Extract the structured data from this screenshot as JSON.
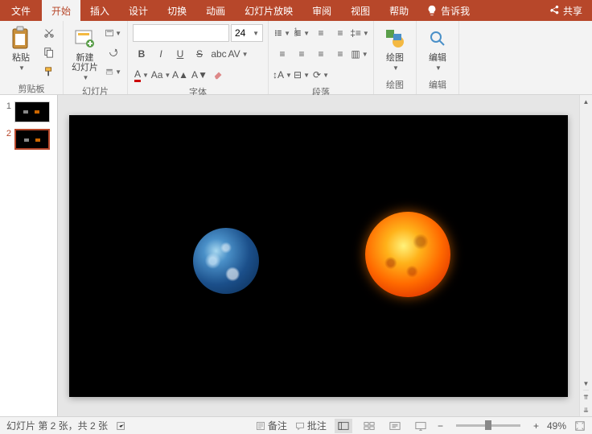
{
  "tabs": {
    "file": "文件",
    "home": "开始",
    "insert": "插入",
    "design": "设计",
    "transitions": "切换",
    "animations": "动画",
    "slideshow": "幻灯片放映",
    "review": "审阅",
    "view": "视图",
    "help": "帮助",
    "tellme": "告诉我",
    "share": "共享"
  },
  "groups": {
    "clipboard": {
      "label": "剪贴板",
      "paste": "粘贴"
    },
    "slides": {
      "label": "幻灯片",
      "newslide": "新建\n幻灯片"
    },
    "font": {
      "label": "字体",
      "size": "24"
    },
    "paragraph": {
      "label": "段落"
    },
    "drawing": {
      "label": "绘图",
      "btn": "绘图"
    },
    "editing": {
      "label": "编辑",
      "btn": "编辑"
    }
  },
  "thumbs": [
    {
      "num": "1",
      "active": false
    },
    {
      "num": "2",
      "active": true
    }
  ],
  "status": {
    "slideinfo": "幻灯片 第 2 张，共 2 张",
    "notes": "备注",
    "comments": "批注",
    "zoom": "49%"
  }
}
